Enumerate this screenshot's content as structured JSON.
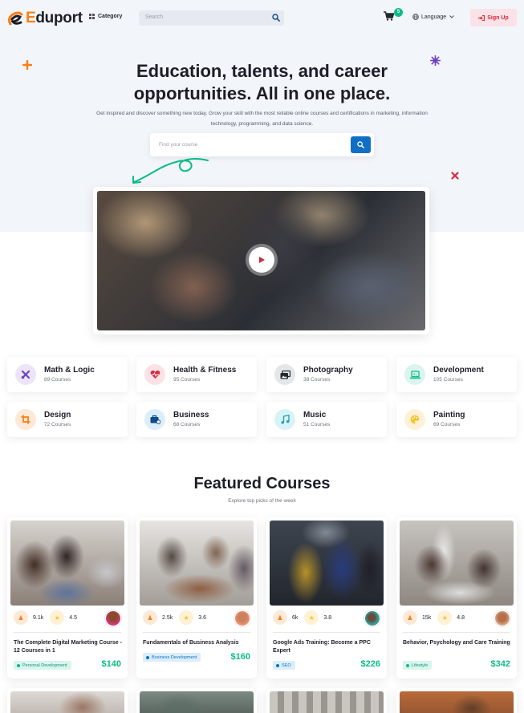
{
  "header": {
    "brand_prefix": "E",
    "brand_rest": "duport",
    "category_label": "Category",
    "search_placeholder": "Search",
    "cart_count": "5",
    "language_label": "Language",
    "signup_label": "Sign Up"
  },
  "hero": {
    "title_line1": "Education, talents, and career",
    "title_line2": "opportunities. All in one place.",
    "subtitle": "Get inspired and discover something new today. Grow your skill with the most reliable online courses and certifications in marketing, information technology, programming, and data science.",
    "search_placeholder": "Find your course"
  },
  "categories": [
    {
      "name": "Math & Logic",
      "count": "89 Courses",
      "icon": "tools-icon",
      "color": "#6f42c1"
    },
    {
      "name": "Health & Fitness",
      "count": "95 Courses",
      "icon": "heartbeat-icon",
      "color": "#d6293e"
    },
    {
      "name": "Photography",
      "count": "38 Courses",
      "icon": "photos-icon",
      "color": "#24292d"
    },
    {
      "name": "Development",
      "count": "105 Courses",
      "icon": "laptop-icon",
      "color": "#0cbc87"
    },
    {
      "name": "Design",
      "count": "72 Courses",
      "icon": "crop-icon",
      "color": "#fd7e14"
    },
    {
      "name": "Business",
      "count": "68 Courses",
      "icon": "briefcase-icon",
      "color": "#0f6fc5"
    },
    {
      "name": "Music",
      "count": "51 Courses",
      "icon": "music-icon",
      "color": "#17a2b8"
    },
    {
      "name": "Painting",
      "count": "69 Courses",
      "icon": "palette-icon",
      "color": "#f7c32e"
    }
  ],
  "featured": {
    "title": "Featured Courses",
    "subtitle": "Explore top picks of the week",
    "courses": [
      {
        "learners": "9.1k",
        "rating": "4.5",
        "title": "The Complete Digital Marketing Course - 12 Courses in 1",
        "tag": "Personal Development",
        "price": "$140"
      },
      {
        "learners": "2.5k",
        "rating": "3.6",
        "title": "Fundamentals of Business Analysis",
        "tag": "Business Development",
        "price": "$160"
      },
      {
        "learners": "6k",
        "rating": "3.8",
        "title": "Google Ads Training: Become a PPC Expert",
        "tag": "SEO",
        "price": "$226"
      },
      {
        "learners": "15k",
        "rating": "4.8",
        "title": "Behavior, Psychology and Care Training",
        "tag": "Lifestyle",
        "price": "$342"
      }
    ]
  },
  "colors": {
    "accent": "#0f6fc5",
    "success": "#0cbc87",
    "danger": "#d6293e",
    "orange": "#fd7e14"
  }
}
